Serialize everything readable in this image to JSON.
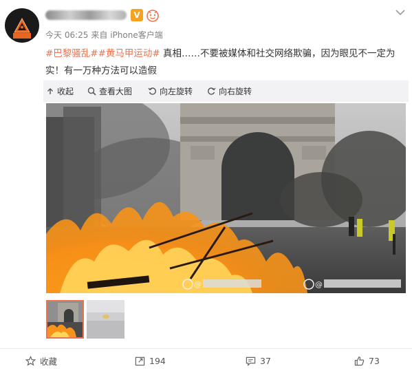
{
  "post": {
    "verified_badge": "V",
    "meta": {
      "time": "今天 06:25",
      "source": "来自 iPhone客户端"
    },
    "content": {
      "tag1": "#巴黎骚乱#",
      "tag2": "#黄马甲运动#",
      "text": " 真相……不要被媒体和社交网络欺骗，因为眼见不一定为实！有一万种方法可以造假"
    },
    "media_actions": {
      "collapse": "收起",
      "view_large": "查看大图",
      "rotate_left": "向左旋转",
      "rotate_right": "向右旋转"
    },
    "watermark_prefix": "@",
    "footer": {
      "favorite": "收藏",
      "repost_count": "194",
      "comment_count": "37",
      "like_count": "73"
    }
  },
  "colors": {
    "tag": "#eb7350",
    "accent": "#f4a21f"
  }
}
